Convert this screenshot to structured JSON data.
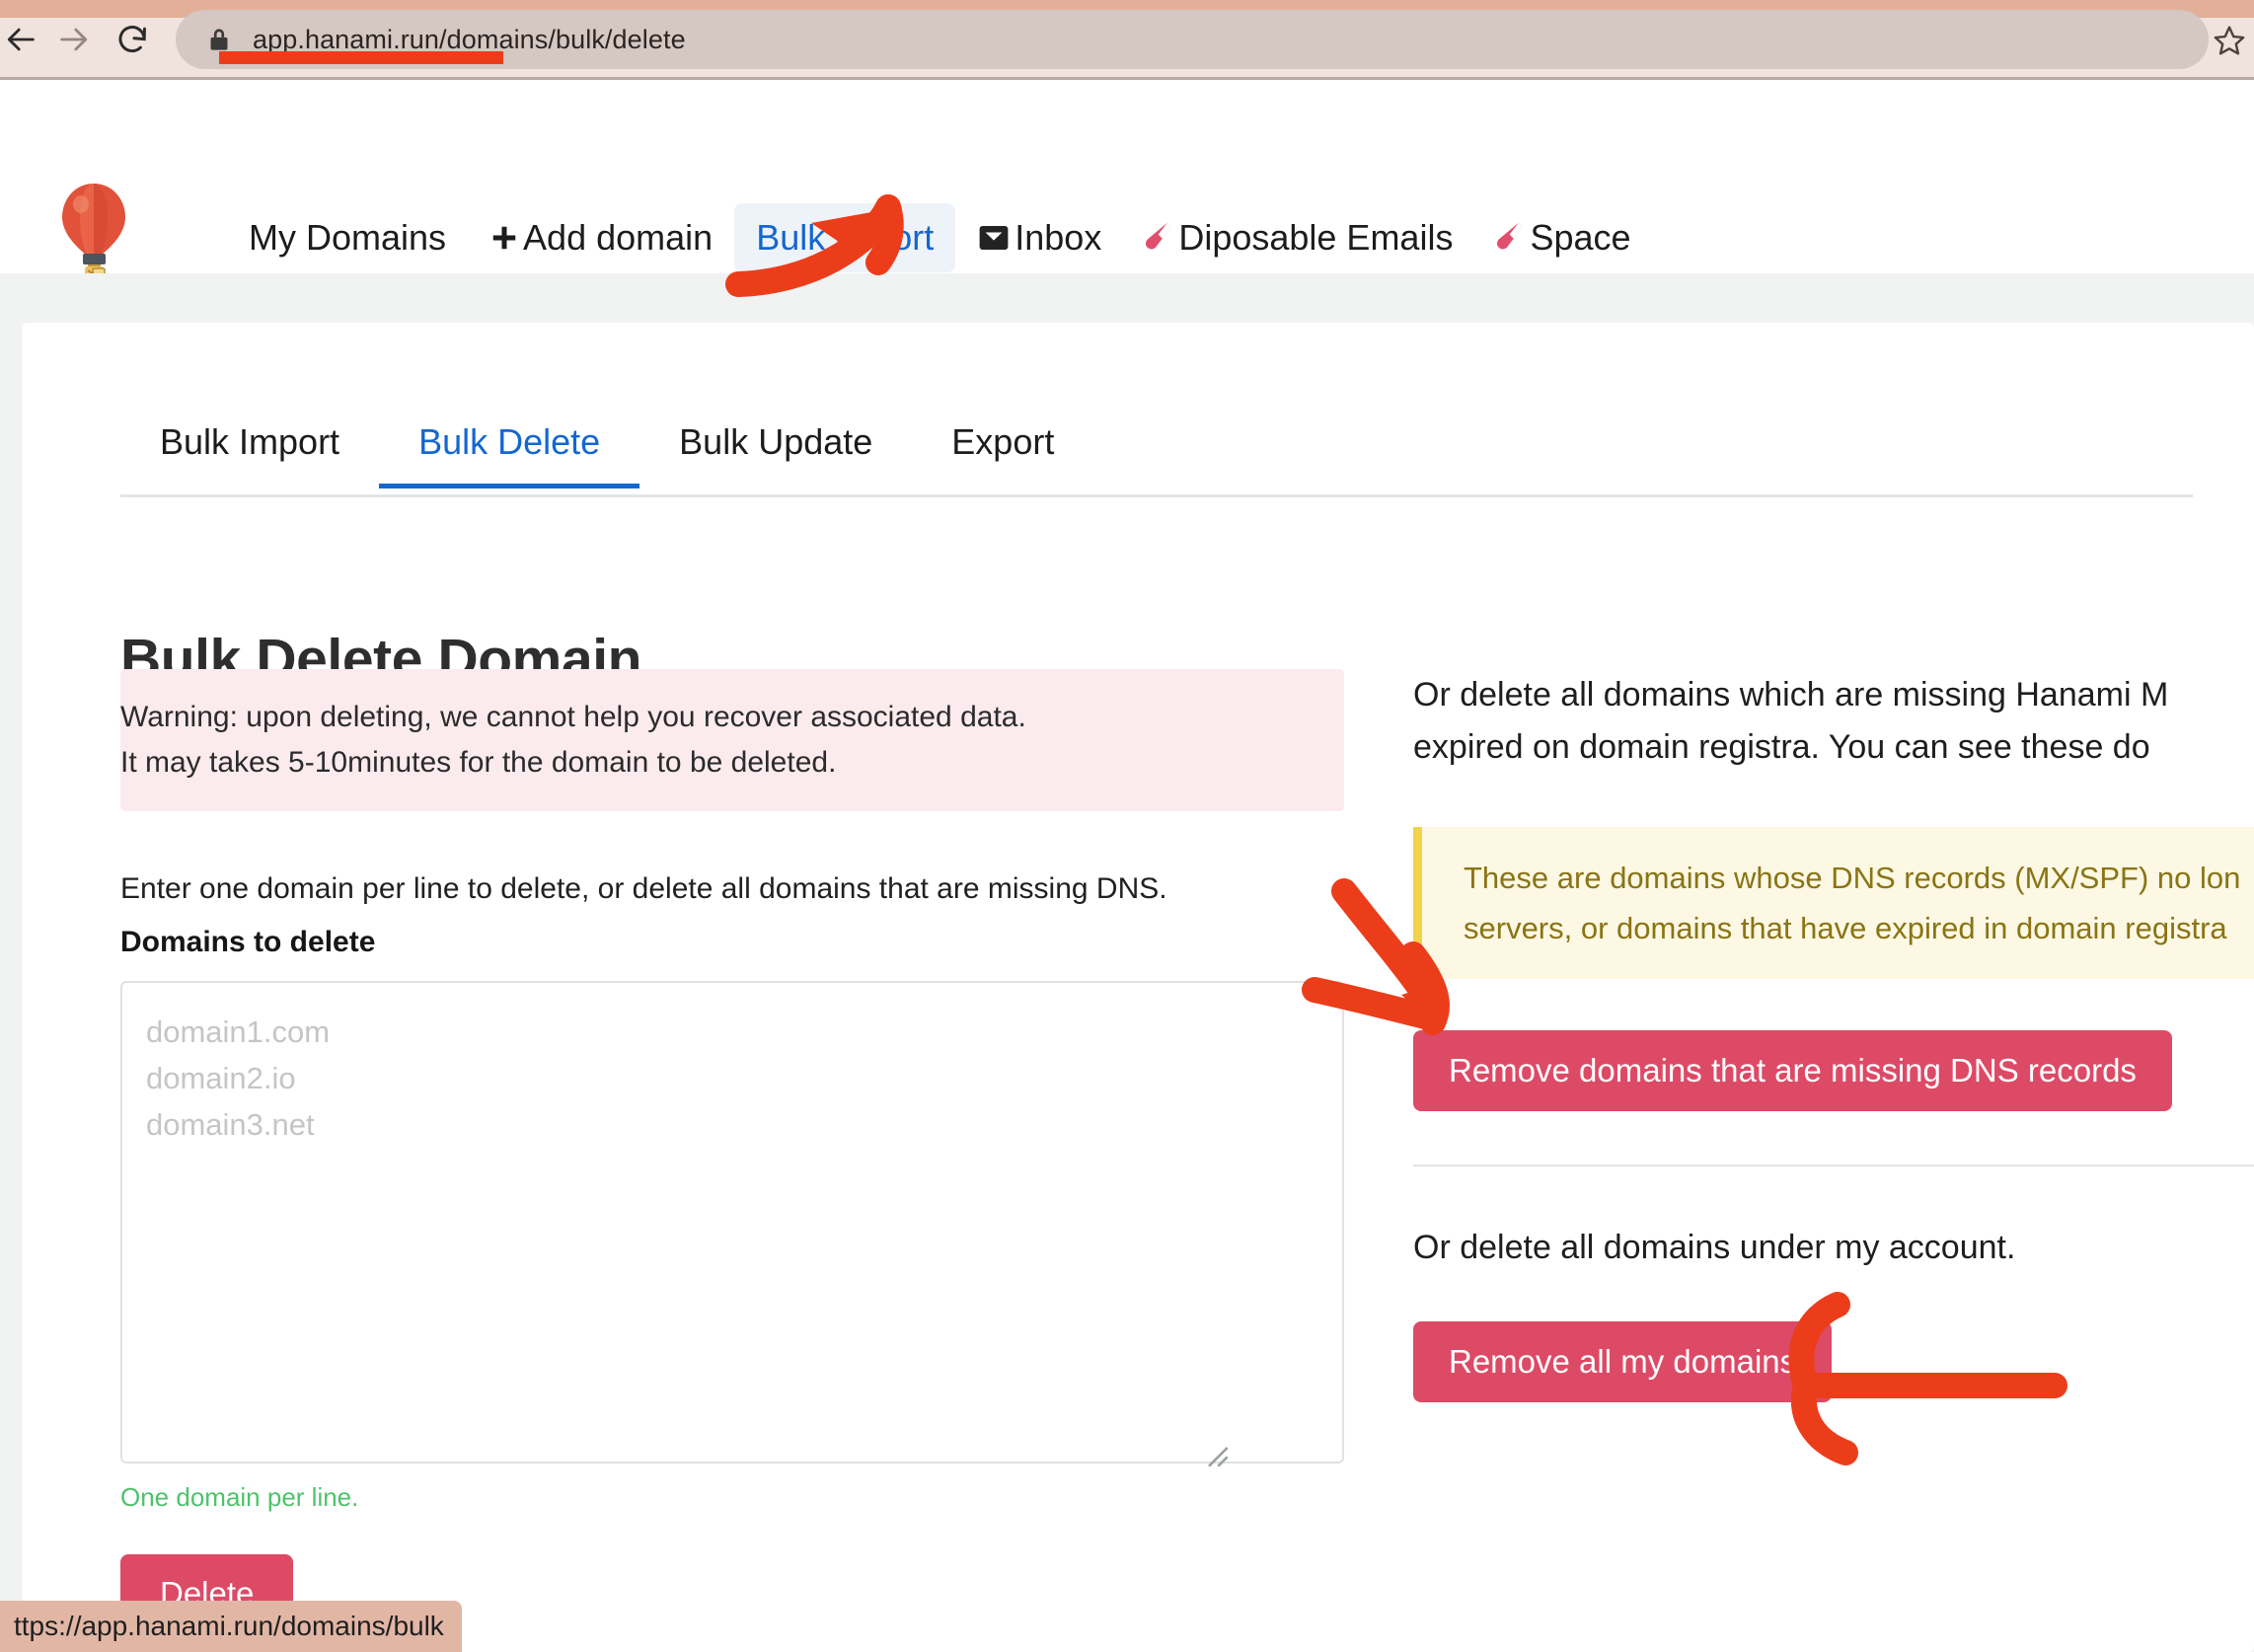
{
  "browser": {
    "url": "app.hanami.run/domains/bulk/delete",
    "back_label": "Back",
    "forward_label": "Forward",
    "reload_label": "Reload",
    "lock_icon": "lock-icon",
    "star_icon": "bookmark-star-icon",
    "status_url": "ttps://app.hanami.run/domains/bulk"
  },
  "header": {
    "logo_alt": "hot-air-balloon-logo",
    "nav": [
      {
        "label": "My Domains",
        "icon": null,
        "active": false
      },
      {
        "label": "Add domain",
        "icon": "plus-icon",
        "active": false
      },
      {
        "label": "Bulk import",
        "icon": null,
        "active": true
      },
      {
        "label": "Inbox",
        "icon": "inbox-icon",
        "active": false
      },
      {
        "label": "Diposable Emails",
        "icon": "vial-icon",
        "active": false
      },
      {
        "label": "Space",
        "icon": "vial-icon",
        "active": false
      }
    ]
  },
  "tabs": [
    {
      "label": "Bulk Import",
      "active": false
    },
    {
      "label": "Bulk Delete",
      "active": true
    },
    {
      "label": "Bulk Update",
      "active": false
    },
    {
      "label": "Export",
      "active": false
    }
  ],
  "page": {
    "title": "Bulk Delete Domain"
  },
  "left": {
    "warning_line1": "Warning: upon deleting, we cannot help you recover associated data.",
    "warning_line2": "It may takes 5-10minutes for the domain to be deleted.",
    "intro": "Enter one domain per line to delete, or delete all domains that are missing DNS.",
    "field_label": "Domains to delete",
    "textarea_value": "",
    "textarea_placeholder": "domain1.com\ndomain2.io\ndomain3.net",
    "help_text": "One domain per line.",
    "delete_button": "Delete"
  },
  "right": {
    "intro_line1": "Or delete all domains which are missing Hanami M",
    "intro_line2": "expired on domain registra. You can see these do",
    "notice_line1": "These are domains whose DNS records (MX/SPF) no lon",
    "notice_line2": "servers, or domains that have expired in domain registra",
    "remove_dns_button": "Remove domains that are missing DNS records",
    "account_para": "Or delete all domains under my account.",
    "remove_all_button": "Remove all my domains"
  },
  "colors": {
    "accent_blue": "#1367d0",
    "danger_pink": "#dd4a66",
    "warning_bg": "#fcebee",
    "notice_bg": "#fcf8e3",
    "notice_border": "#f2d24b",
    "notice_text": "#8a7415",
    "help_green": "#4fc26b",
    "annotation_red": "#ec3d1b",
    "chrome_bg": "#f0e2dc",
    "omnibox_bg": "#d5c7c1"
  }
}
